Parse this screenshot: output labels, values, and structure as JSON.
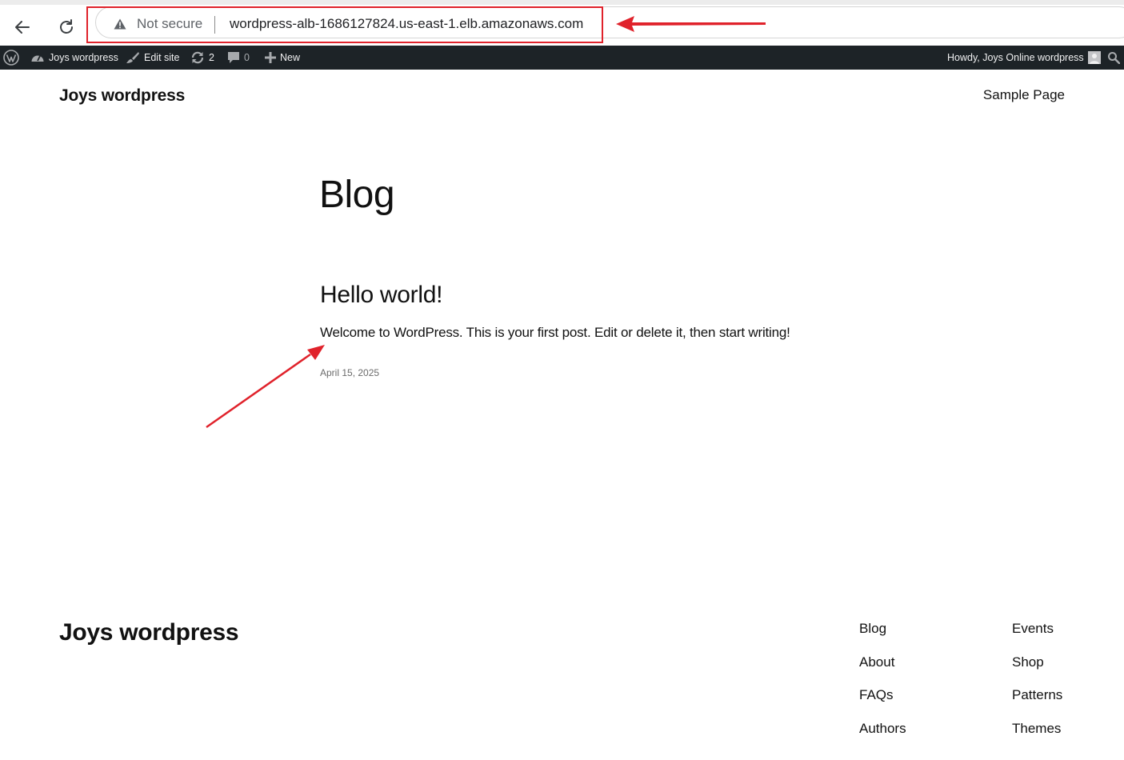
{
  "browser": {
    "security_label": "Not secure",
    "url": "wordpress-alb-1686127824.us-east-1.elb.amazonaws.com",
    "annotation_color": "#e0222b"
  },
  "admin_bar": {
    "site_name": "Joys wordpress",
    "edit_site": "Edit site",
    "updates_count": "2",
    "comments_count": "0",
    "new_label": "New",
    "greeting": "Howdy, Joys Online wordpress"
  },
  "header": {
    "site_title": "Joys wordpress",
    "nav_item": "Sample Page"
  },
  "main": {
    "heading": "Blog",
    "post": {
      "title": "Hello world!",
      "excerpt": "Welcome to WordPress. This is your first post. Edit or delete it, then start writing!",
      "date": "April 15, 2025"
    }
  },
  "footer": {
    "site_title": "Joys wordpress",
    "links_left": [
      "Blog",
      "About",
      "FAQs",
      "Authors"
    ],
    "links_right": [
      "Events",
      "Shop",
      "Patterns",
      "Themes"
    ]
  },
  "colors": {
    "admin_bar_bg": "#1d2327",
    "text": "#111111"
  }
}
